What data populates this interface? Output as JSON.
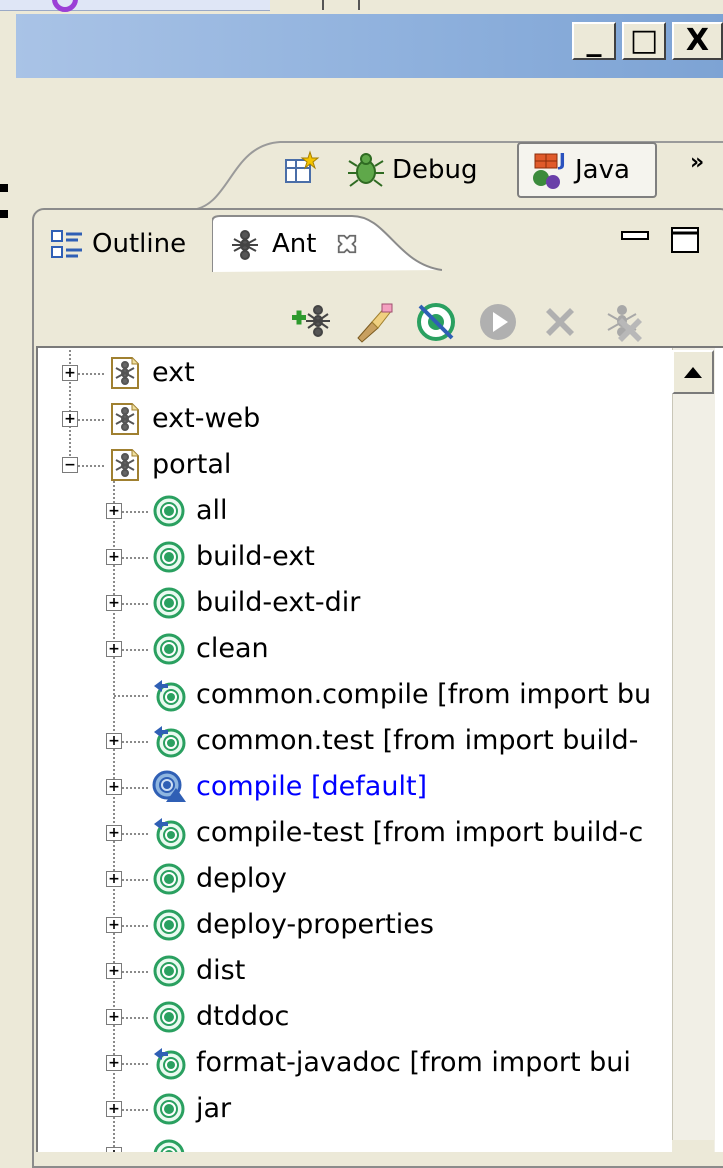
{
  "window": {
    "minimize": "_",
    "maximize": "□",
    "close": "X"
  },
  "perspectives": {
    "debug_label": "Debug",
    "java_label": "Java",
    "overflow": "»"
  },
  "tabs": {
    "outline_label": "Outline",
    "ant_label": "Ant"
  },
  "tree": [
    {
      "label": "ext",
      "level": 0,
      "kind": "buildfile",
      "expander": "+"
    },
    {
      "label": "ext-web",
      "level": 0,
      "kind": "buildfile",
      "expander": "+"
    },
    {
      "label": "portal",
      "level": 0,
      "kind": "buildfile",
      "expander": "-"
    },
    {
      "label": "all",
      "level": 1,
      "kind": "target",
      "expander": "+"
    },
    {
      "label": "build-ext",
      "level": 1,
      "kind": "target",
      "expander": "+"
    },
    {
      "label": "build-ext-dir",
      "level": 1,
      "kind": "target",
      "expander": "+"
    },
    {
      "label": "clean",
      "level": 1,
      "kind": "target",
      "expander": "+"
    },
    {
      "label": "common.compile [from import bu",
      "level": 1,
      "kind": "imported",
      "expander": ""
    },
    {
      "label": "common.test [from import build-",
      "level": 1,
      "kind": "imported",
      "expander": "+"
    },
    {
      "label": "compile [default]",
      "level": 1,
      "kind": "default",
      "expander": "+"
    },
    {
      "label": "compile-test [from import build-c",
      "level": 1,
      "kind": "imported",
      "expander": "+"
    },
    {
      "label": "deploy",
      "level": 1,
      "kind": "target",
      "expander": "+"
    },
    {
      "label": "deploy-properties",
      "level": 1,
      "kind": "target",
      "expander": "+"
    },
    {
      "label": "dist",
      "level": 1,
      "kind": "target",
      "expander": "+"
    },
    {
      "label": "dtddoc",
      "level": 1,
      "kind": "target",
      "expander": "+"
    },
    {
      "label": "format-javadoc [from import bui",
      "level": 1,
      "kind": "imported",
      "expander": "+"
    },
    {
      "label": "jar",
      "level": 1,
      "kind": "target",
      "expander": "+"
    },
    {
      "label": "",
      "level": 1,
      "kind": "target",
      "expander": "+"
    }
  ]
}
